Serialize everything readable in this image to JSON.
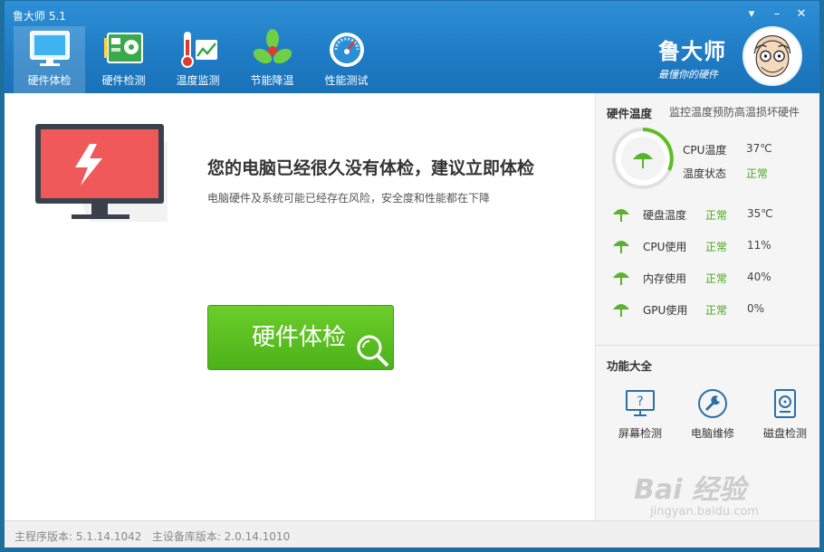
{
  "app": {
    "title": "鲁大师 5.1"
  },
  "window_controls": {
    "menu": "▾",
    "minimize": "–",
    "close": "✕"
  },
  "nav": [
    {
      "label": "硬件体检",
      "icon": "monitor-icon",
      "active": true
    },
    {
      "label": "硬件检测",
      "icon": "circuit-board-icon",
      "active": false
    },
    {
      "label": "温度监测",
      "icon": "thermometer-icon",
      "active": false
    },
    {
      "label": "节能降温",
      "icon": "fan-icon",
      "active": false
    },
    {
      "label": "性能测试",
      "icon": "speedometer-icon",
      "active": false
    }
  ],
  "brand": {
    "name": "鲁大师",
    "slogan": "最懂你的硬件"
  },
  "main": {
    "headline": "您的电脑已经很久没有体检，建议立即体检",
    "subline": "电脑硬件及系统可能已经存在风险，安全度和性能都在下降",
    "check_button": "硬件体检"
  },
  "temperature": {
    "title": "硬件温度",
    "note": "监控温度预防高温损坏硬件",
    "cpu_temp_label": "CPU温度",
    "cpu_temp_value": "37℃",
    "state_label": "温度状态",
    "state_value": "正常",
    "metrics": [
      {
        "name": "硬盘温度",
        "status": "正常",
        "value": "35℃"
      },
      {
        "name": "CPU使用",
        "status": "正常",
        "value": "11%"
      },
      {
        "name": "内存使用",
        "status": "正常",
        "value": "40%"
      },
      {
        "name": "GPU使用",
        "status": "正常",
        "value": "0%"
      }
    ]
  },
  "tools": {
    "title": "功能大全",
    "items": [
      {
        "label": "屏幕检测",
        "icon": "screen-check-icon"
      },
      {
        "label": "电脑维修",
        "icon": "wrench-icon"
      },
      {
        "label": "磁盘检测",
        "icon": "disk-icon"
      }
    ]
  },
  "footer": {
    "version": "主程序版本: 5.1.14.1042   主设备库版本: 2.0.14.1010"
  },
  "watermark": {
    "main": "Bai 经验",
    "sub": "jingyan.baidu.com"
  },
  "colors": {
    "header": "#1e7bc4",
    "accent_green": "#45a817",
    "button_green": "#55b81e"
  }
}
